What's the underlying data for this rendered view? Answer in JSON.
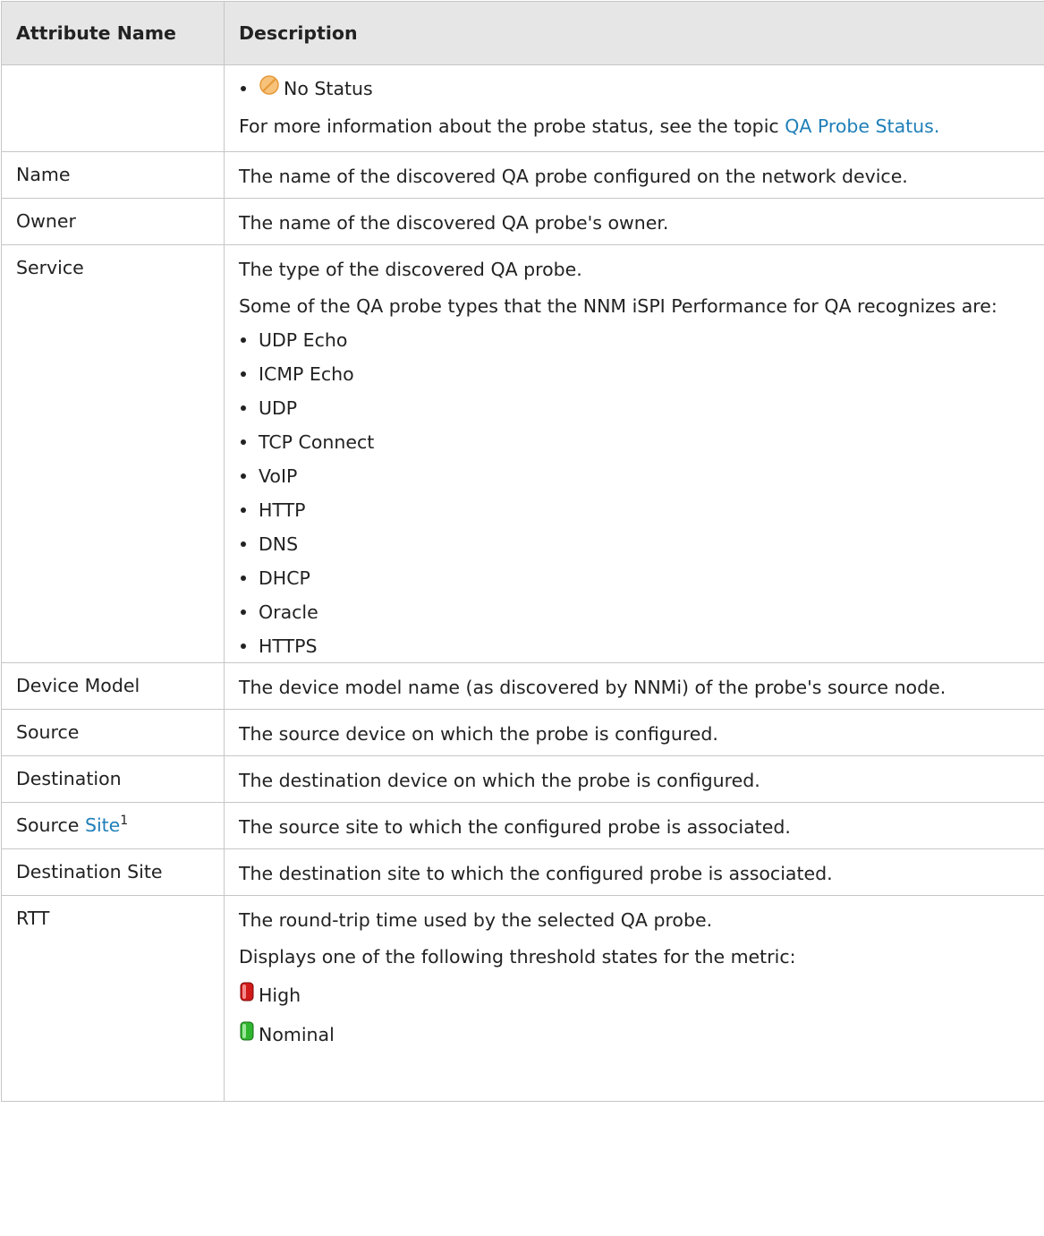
{
  "headers": {
    "attribute": "Attribute Name",
    "description": "Description"
  },
  "status_row": {
    "bullet_label": "No Status",
    "info_text": "For more information about the probe status, see the topic ",
    "info_link": "QA Probe Status."
  },
  "rows": {
    "name": {
      "label": "Name",
      "desc": "The name of the discovered QA probe configured on the network device."
    },
    "owner": {
      "label": "Owner",
      "desc": "The name of the discovered QA probe's owner."
    },
    "service": {
      "label": "Service",
      "desc": "The type of the discovered QA probe.",
      "desc2": "Some of the QA probe types that the NNM iSPI Performance for QA recognizes are:",
      "types": [
        "UDP Echo",
        "ICMP Echo",
        "UDP",
        "TCP Connect",
        "VoIP",
        "HTTP",
        "DNS",
        "DHCP",
        "Oracle",
        "HTTPS"
      ]
    },
    "device_model": {
      "label": "Device Model",
      "desc": "The device model name (as discovered by NNMi) of the probe's source node."
    },
    "source": {
      "label": "Source",
      "desc": "The source device on which the probe is configured."
    },
    "destination": {
      "label": "Destination",
      "desc": "The destination device on which the probe is configured."
    },
    "source_site": {
      "label_prefix": "Source ",
      "label_link": "Site",
      "footnote": "1",
      "desc": "The source site to which the configured probe is associated."
    },
    "destination_site": {
      "label": "Destination Site",
      "desc": "The destination site to which the configured probe is associated."
    },
    "rtt": {
      "label": "RTT",
      "desc": "The round-trip time used by the selected QA probe.",
      "desc2": "Displays one of the following threshold states for the metric:",
      "state_high": "High",
      "state_nominal": "Nominal"
    }
  },
  "colors": {
    "link": "#1f7fb8",
    "header_bg": "#e6e6e6",
    "border": "#c6c6c6"
  },
  "icons": {
    "no_status": "no-status-icon",
    "high": "high-threshold-icon",
    "nominal": "nominal-threshold-icon"
  }
}
